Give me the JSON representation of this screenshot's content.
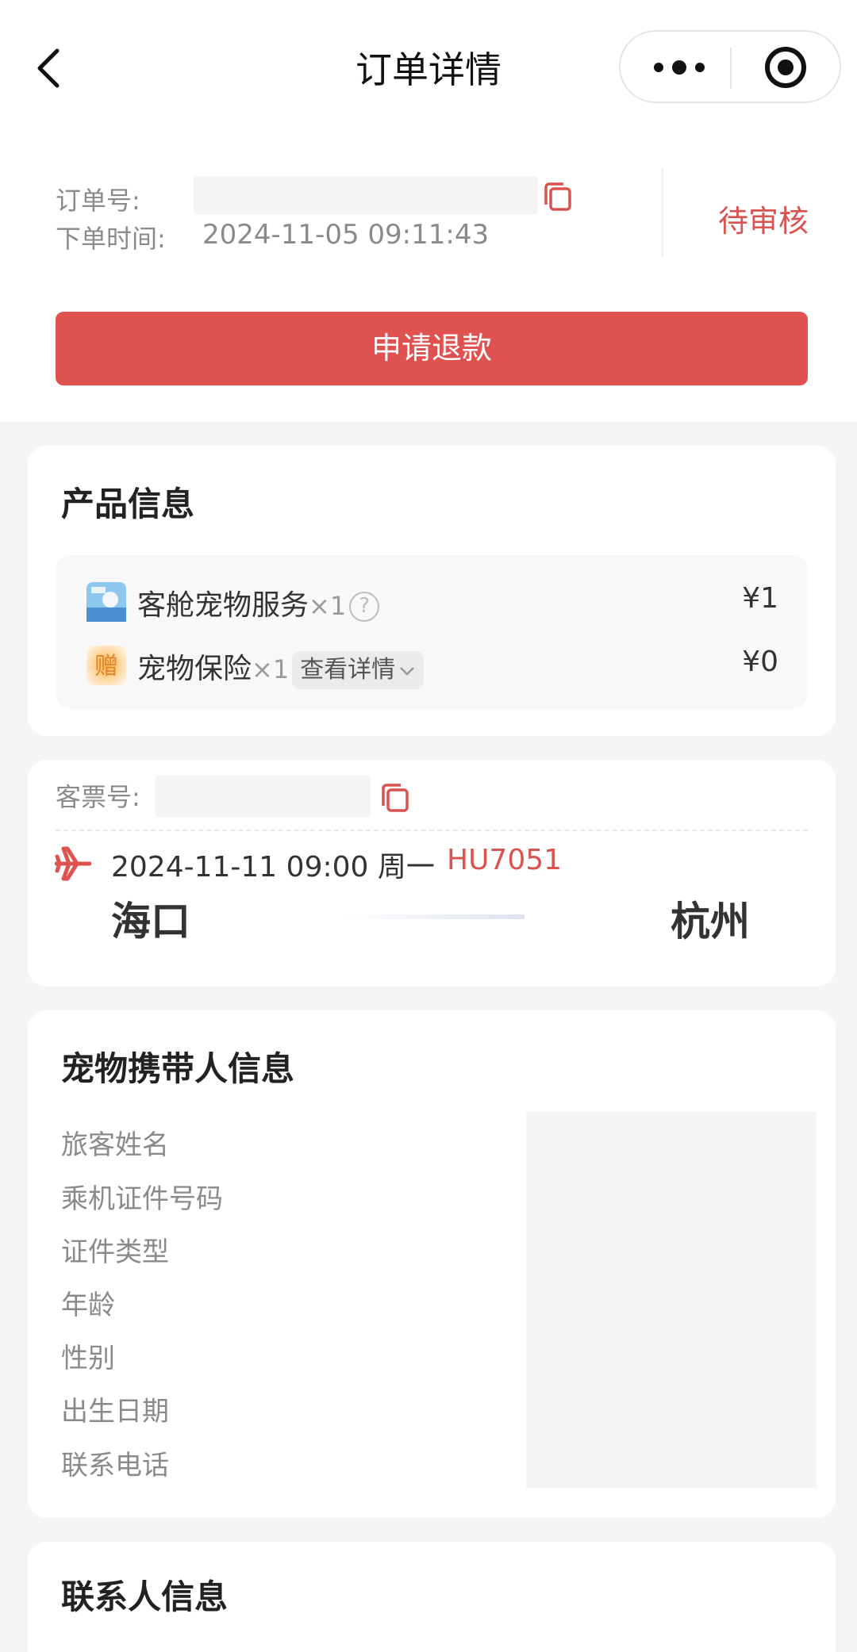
{
  "nav": {
    "title": "订单详情"
  },
  "order": {
    "number_label": "订单号:",
    "time_label": "下单时间:",
    "time_value": "2024-11-05 09:11:43",
    "status": "待审核",
    "refund_button": "申请退款"
  },
  "product": {
    "title": "产品信息",
    "items": [
      {
        "name": "客舱宠物服务",
        "qty": "×1",
        "price": "¥1",
        "icon": "cabin-pet-service-thumbnail"
      },
      {
        "name": "宠物保险",
        "qty": "×1",
        "detail_label": "查看详情",
        "price": "¥0",
        "icon": "gift-zeng-badge",
        "badge_text": "赠"
      }
    ]
  },
  "ticket": {
    "number_label": "客票号:",
    "datetime": "2024-11-11 09:00 周一",
    "flight_no": "HU7051",
    "from_city": "海口",
    "to_city": "杭州"
  },
  "passenger": {
    "title": "宠物携带人信息",
    "fields": [
      "旅客姓名",
      "乘机证件号码",
      "证件类型",
      "年龄",
      "性别",
      "出生日期",
      "联系电话"
    ]
  },
  "contact": {
    "title": "联系人信息"
  },
  "colors": {
    "accent": "#e0524f",
    "status": "#d9534f",
    "background": "#f5f5f5"
  }
}
